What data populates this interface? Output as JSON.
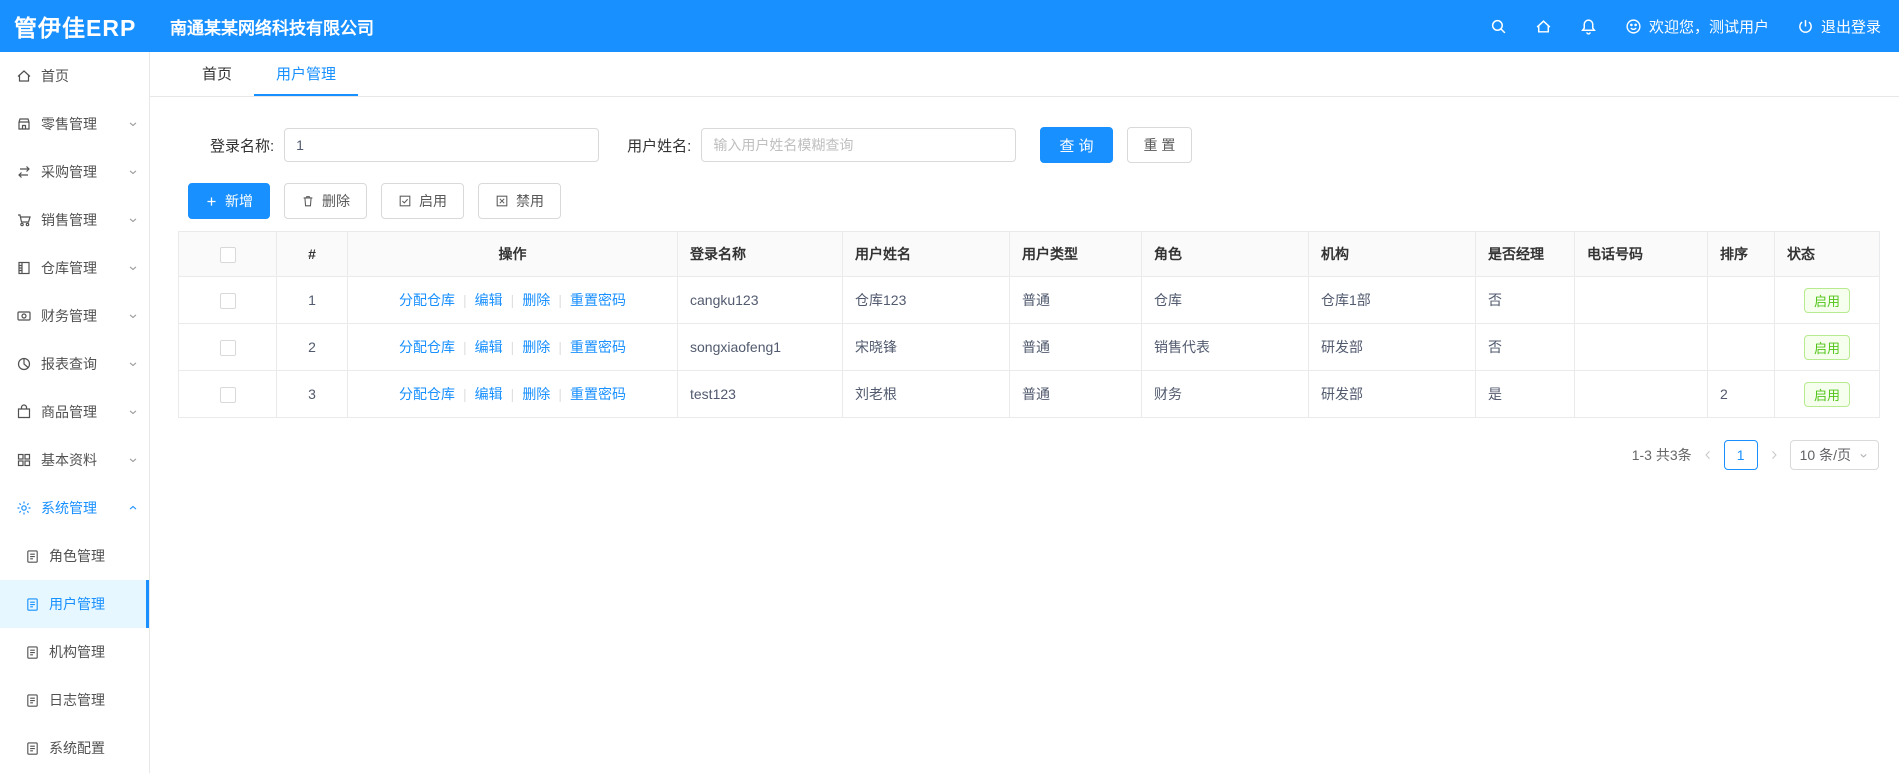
{
  "header": {
    "logo": "管伊佳ERP",
    "company": "南通某某网络科技有限公司",
    "welcome": "欢迎您，测试用户",
    "logout": "退出登录"
  },
  "sidebar": {
    "items": [
      {
        "label": "首页"
      },
      {
        "label": "零售管理"
      },
      {
        "label": "采购管理"
      },
      {
        "label": "销售管理"
      },
      {
        "label": "仓库管理"
      },
      {
        "label": "财务管理"
      },
      {
        "label": "报表查询"
      },
      {
        "label": "商品管理"
      },
      {
        "label": "基本资料"
      },
      {
        "label": "系统管理"
      }
    ],
    "system_children": [
      {
        "label": "角色管理"
      },
      {
        "label": "用户管理"
      },
      {
        "label": "机构管理"
      },
      {
        "label": "日志管理"
      },
      {
        "label": "系统配置"
      }
    ]
  },
  "tabs": {
    "home": "首页",
    "user_management": "用户管理"
  },
  "filters": {
    "login_label": "登录名称:",
    "login_value": "1",
    "name_label": "用户姓名:",
    "name_placeholder": "输入用户姓名模糊查询",
    "search_button": "查 询",
    "reset_button": "重 置"
  },
  "toolbar": {
    "add": "新增",
    "delete": "删除",
    "enable": "启用",
    "disable": "禁用"
  },
  "table": {
    "headers": {
      "index": "#",
      "operation": "操作",
      "login_name": "登录名称",
      "user_name": "用户姓名",
      "user_type": "用户类型",
      "role": "角色",
      "org": "机构",
      "is_manager": "是否经理",
      "phone": "电话号码",
      "sort": "排序",
      "status": "状态"
    },
    "operations": {
      "assign": "分配仓库",
      "edit": "编辑",
      "delete": "删除",
      "reset_pwd": "重置密码"
    },
    "rows": [
      {
        "index": "1",
        "login_name": "cangku123",
        "user_name": "仓库123",
        "user_type": "普通",
        "role": "仓库",
        "org": "仓库1部",
        "is_manager": "否",
        "phone": "",
        "sort": "",
        "status": "启用"
      },
      {
        "index": "2",
        "login_name": "songxiaofeng1",
        "user_name": "宋晓锋",
        "user_type": "普通",
        "role": "销售代表",
        "org": "研发部",
        "is_manager": "否",
        "phone": "",
        "sort": "",
        "status": "启用"
      },
      {
        "index": "3",
        "login_name": "test123",
        "user_name": "刘老根",
        "user_type": "普通",
        "role": "财务",
        "org": "研发部",
        "is_manager": "是",
        "phone": "",
        "sort": "2",
        "status": "启用"
      }
    ]
  },
  "pagination": {
    "total_text": "1-3 共3条",
    "current_page": "1",
    "page_size": "10 条/页"
  }
}
